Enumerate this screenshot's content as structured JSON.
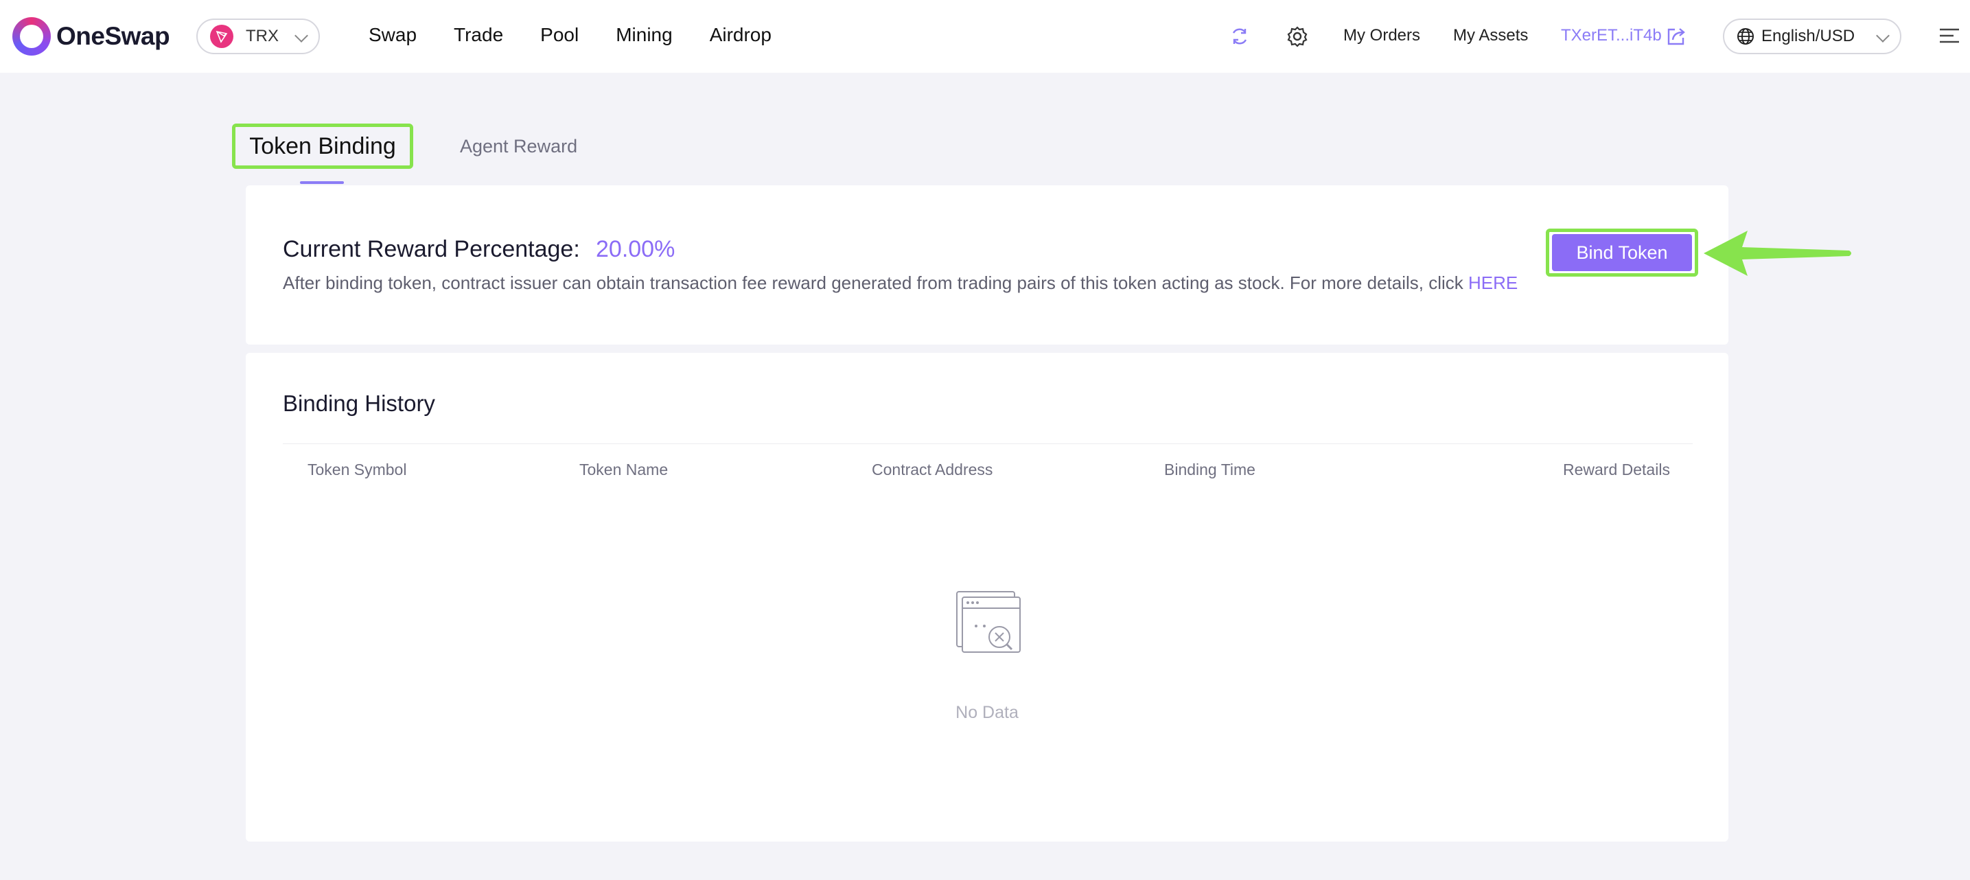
{
  "header": {
    "brand": "OneSwap",
    "chain": "TRX",
    "nav": [
      "Swap",
      "Trade",
      "Pool",
      "Mining",
      "Airdrop"
    ],
    "my_orders": "My Orders",
    "my_assets": "My Assets",
    "wallet_address": "TXerET...iT4b",
    "language": "English/USD"
  },
  "tabs": {
    "active": "Token Binding",
    "other": "Agent Reward"
  },
  "reward": {
    "title": "Current Reward Percentage:",
    "value": "20.00%",
    "description": "After binding token, contract issuer can obtain transaction fee reward generated from trading pairs of this token acting as stock. For more details, click",
    "link": "HERE",
    "bind_button": "Bind Token"
  },
  "history": {
    "title": "Binding History",
    "columns": [
      "Token Symbol",
      "Token Name",
      "Contract Address",
      "Binding Time",
      "Reward Details"
    ],
    "empty_text": "No Data"
  },
  "colors": {
    "accent": "#8b6cf6",
    "highlight": "#87e34d",
    "trx": "#e8347f"
  }
}
